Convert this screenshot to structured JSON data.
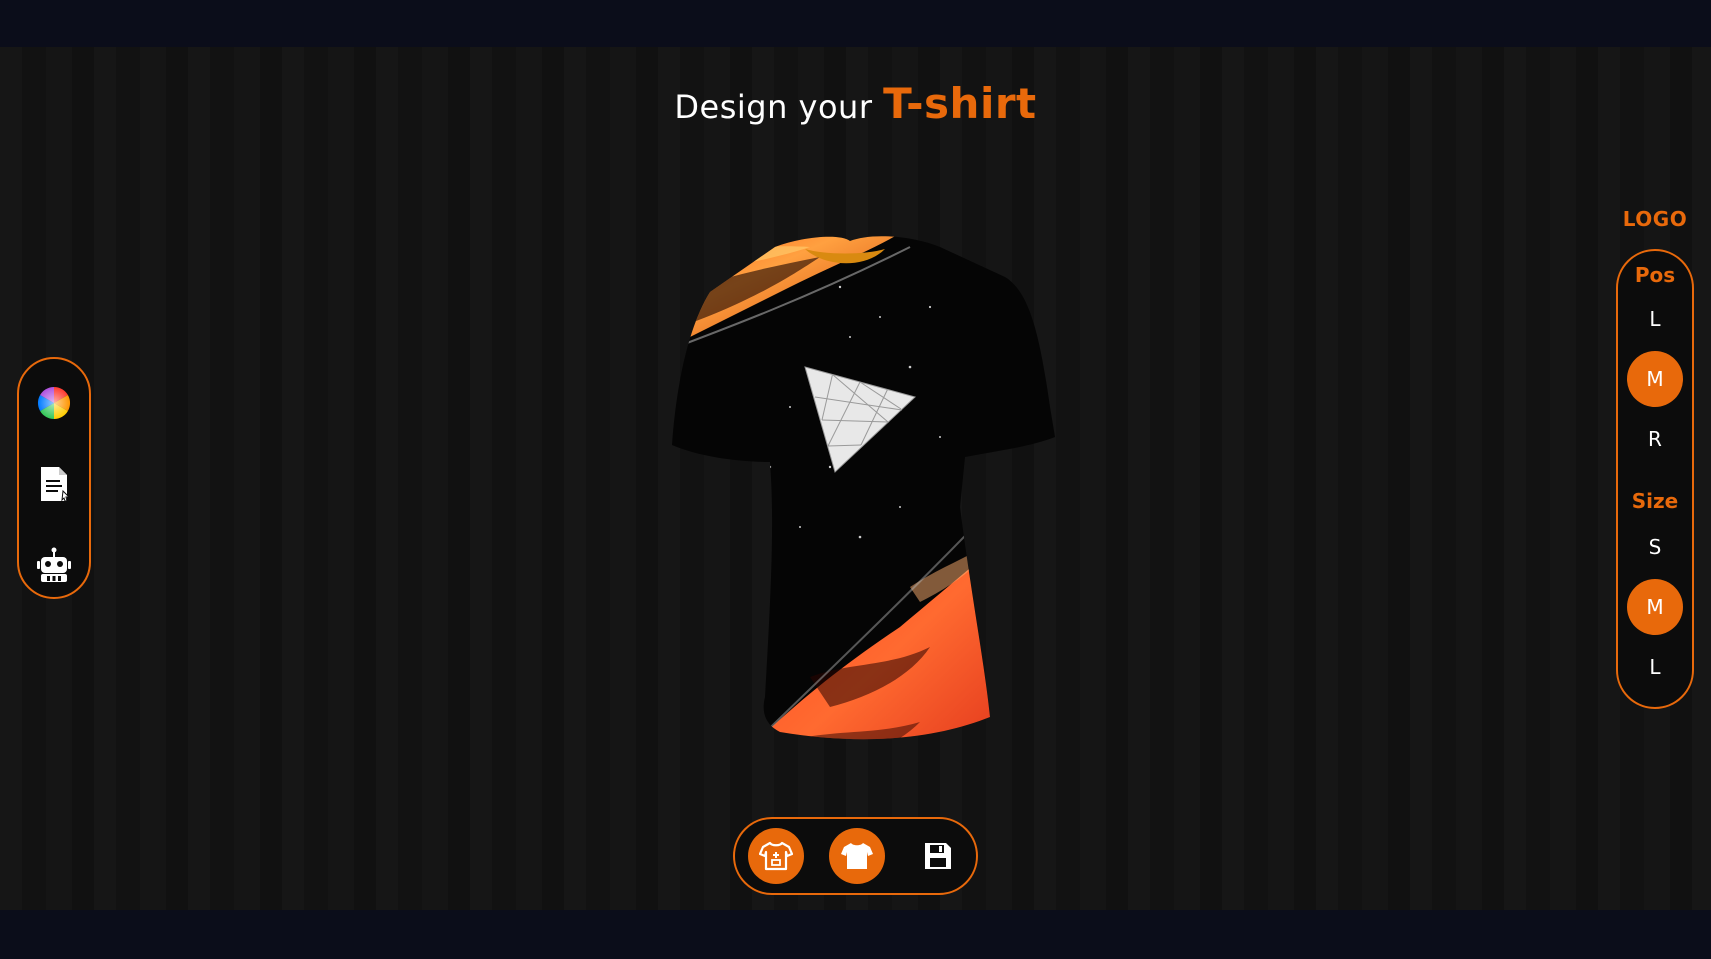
{
  "header": {
    "title_prefix": "Design your",
    "title_accent": "T-shirt"
  },
  "left_toolbar": {
    "tools": [
      {
        "icon": "color-wheel-icon"
      },
      {
        "icon": "file-icon"
      },
      {
        "icon": "robot-icon"
      }
    ]
  },
  "logo_panel": {
    "label": "LOGO",
    "position": {
      "heading": "Pos",
      "options": [
        "L",
        "M",
        "R"
      ],
      "selected": "M"
    },
    "size": {
      "heading": "Size",
      "options": [
        "S",
        "M",
        "L"
      ],
      "selected": "M"
    }
  },
  "bottom_toolbar": {
    "buttons": [
      {
        "icon": "logo-shirt-icon"
      },
      {
        "icon": "full-shirt-icon"
      },
      {
        "icon": "save-icon"
      }
    ]
  },
  "colors": {
    "accent": "#e8690b",
    "background": "#141414",
    "frame": "#0b0d1a"
  }
}
